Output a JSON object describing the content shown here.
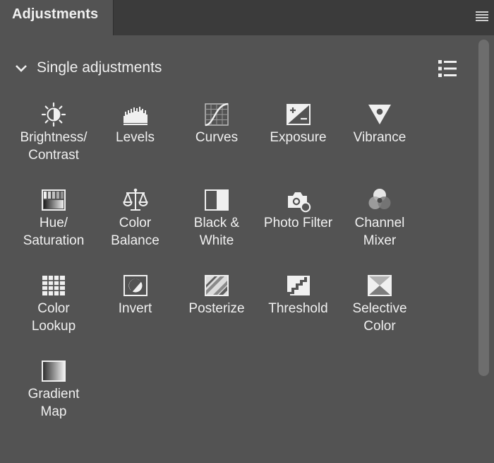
{
  "panel": {
    "tab_label": "Adjustments",
    "menu_icon": "hamburger-menu-icon"
  },
  "section": {
    "title": "Single adjustments",
    "expanded": true,
    "view_icon": "list-view-icon"
  },
  "adjustments": [
    {
      "label": "Brightness/\nContrast",
      "icon": "brightness-contrast-icon"
    },
    {
      "label": "Levels",
      "icon": "levels-icon"
    },
    {
      "label": "Curves",
      "icon": "curves-icon"
    },
    {
      "label": "Exposure",
      "icon": "exposure-icon"
    },
    {
      "label": "Vibrance",
      "icon": "vibrance-icon"
    },
    {
      "label": "Hue/\nSaturation",
      "icon": "hue-saturation-icon"
    },
    {
      "label": "Color\nBalance",
      "icon": "color-balance-icon"
    },
    {
      "label": "Black &\nWhite",
      "icon": "black-white-icon"
    },
    {
      "label": "Photo Filter",
      "icon": "photo-filter-icon"
    },
    {
      "label": "Channel\nMixer",
      "icon": "channel-mixer-icon"
    },
    {
      "label": "Color\nLookup",
      "icon": "color-lookup-icon"
    },
    {
      "label": "Invert",
      "icon": "invert-icon"
    },
    {
      "label": "Posterize",
      "icon": "posterize-icon"
    },
    {
      "label": "Threshold",
      "icon": "threshold-icon"
    },
    {
      "label": "Selective\nColor",
      "icon": "selective-color-icon"
    },
    {
      "label": "Gradient\nMap",
      "icon": "gradient-map-icon"
    }
  ]
}
